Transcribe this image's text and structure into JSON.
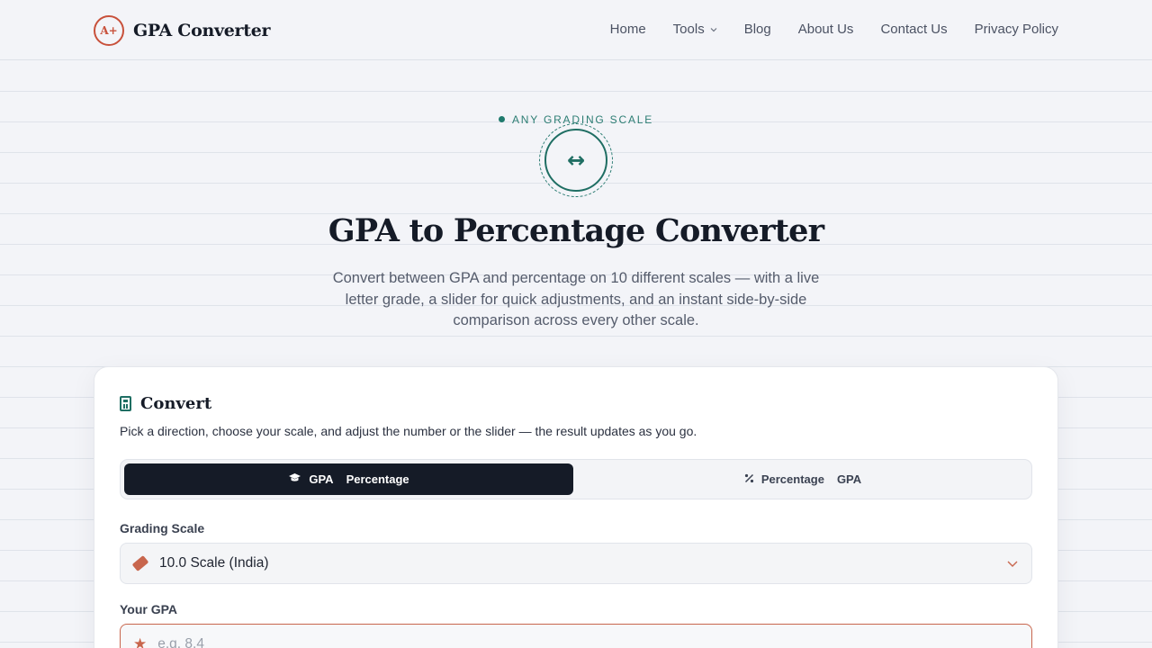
{
  "header": {
    "logo_badge": "A+",
    "brand": "GPA Converter",
    "nav": [
      "Home",
      "Tools",
      "Blog",
      "About Us",
      "Contact Us",
      "Privacy Policy"
    ]
  },
  "hero": {
    "eyebrow": "ANY GRADING SCALE",
    "icon": "↔",
    "title": "GPA to Percentage Converter",
    "subtitle": "Convert between GPA and percentage on 10 different scales — with a live letter grade, a slider for quick adjustments, and an instant side-by-side comparison across every other scale."
  },
  "card": {
    "title": "Convert",
    "description": "Pick a direction, choose your scale, and adjust the number or the slider — the result updates as you go.",
    "toggle": {
      "active": {
        "from": "GPA",
        "to": "Percentage",
        "icon": "graduation-cap-icon"
      },
      "inactive": {
        "from": "Percentage",
        "to": "GPA",
        "icon": "percent-icon"
      }
    },
    "scale_label": "Grading Scale",
    "scale_value": "10.0 Scale (India)",
    "gpa_label": "Your GPA",
    "gpa_value": "",
    "gpa_placeholder": "e.g. 8.4"
  },
  "colors": {
    "accent_teal": "#1f6e63",
    "accent_terracotta": "#c8664d",
    "dark": "#151b27"
  }
}
